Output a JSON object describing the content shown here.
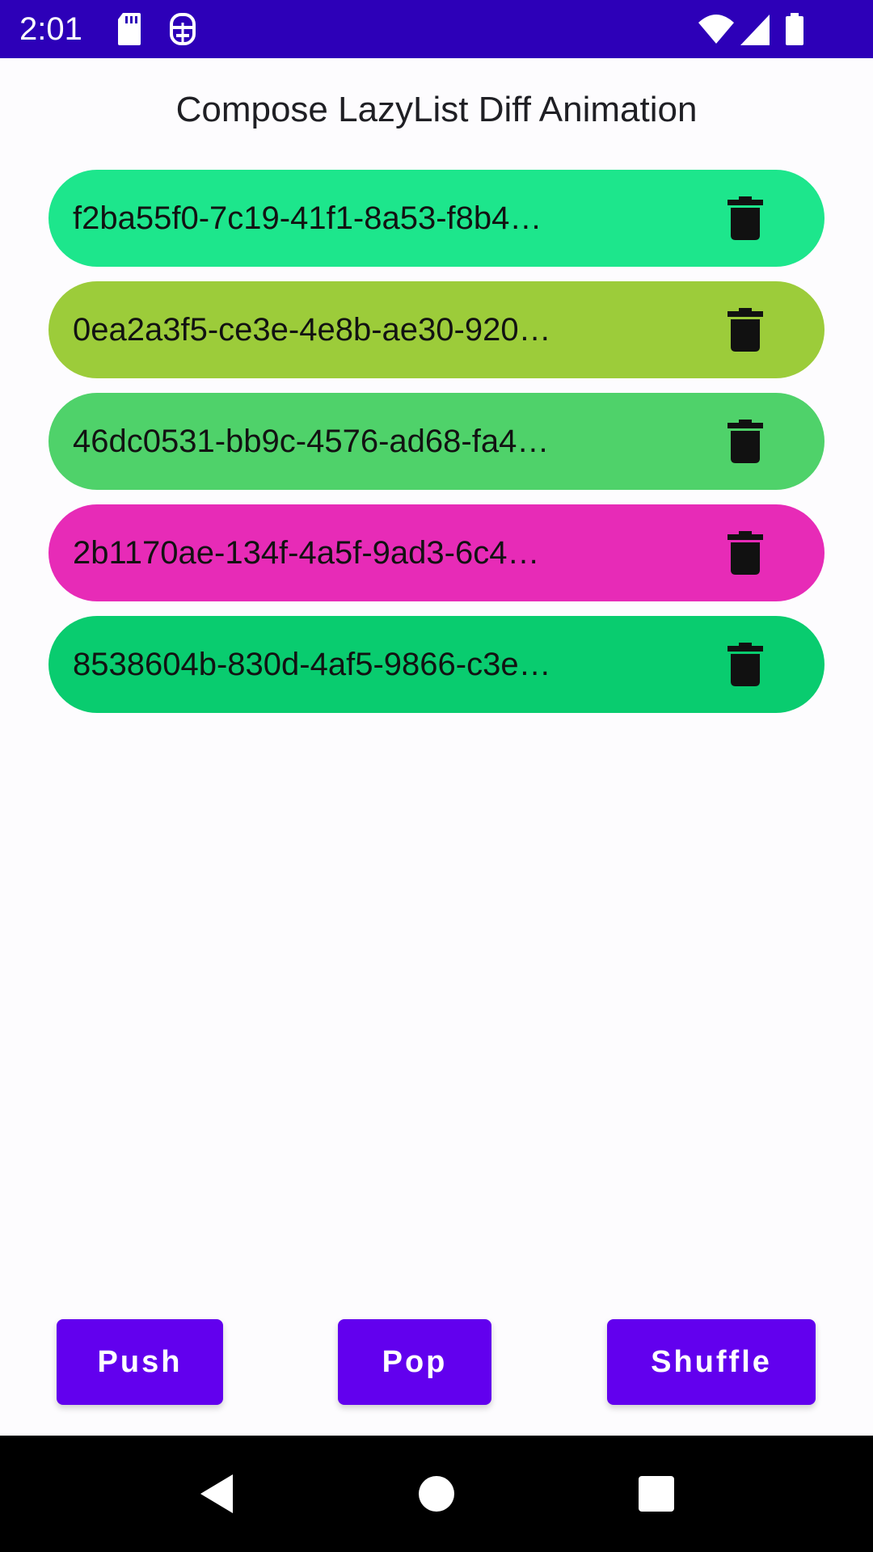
{
  "status_bar": {
    "time": "2:01",
    "background": "#2d00b8",
    "icons": [
      "sd-card-icon",
      "debug-icon",
      "wifi-icon",
      "signal-icon",
      "battery-icon"
    ]
  },
  "app": {
    "title": "Compose LazyList Diff Animation"
  },
  "list": {
    "items": [
      {
        "label": "f2ba55f0-7c19-41f1-8a53-f8b4…",
        "color": "#1de68c",
        "action_icon": "trash-icon"
      },
      {
        "label": "0ea2a3f5-ce3e-4e8b-ae30-920…",
        "color": "#9ccc3a",
        "action_icon": "trash-icon"
      },
      {
        "label": "46dc0531-bb9c-4576-ad68-fa4…",
        "color": "#4fd26a",
        "action_icon": "trash-icon"
      },
      {
        "label": "2b1170ae-134f-4a5f-9ad3-6c4…",
        "color": "#e72bb7",
        "action_icon": "trash-icon"
      },
      {
        "label": "8538604b-830d-4af5-9866-c3e…",
        "color": "#09cc6f",
        "action_icon": "trash-icon"
      }
    ]
  },
  "buttons": {
    "push_label": "Push",
    "pop_label": "Pop",
    "shuffle_label": "Shuffle",
    "color": "#6200ee"
  },
  "nav_bar": {
    "icons": [
      "back-icon",
      "home-icon",
      "recents-icon"
    ]
  }
}
